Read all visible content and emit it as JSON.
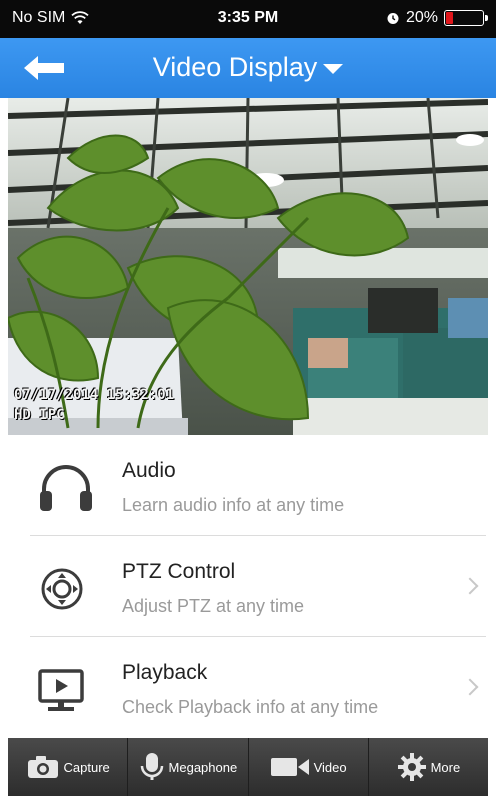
{
  "status_bar": {
    "carrier": "No SIM",
    "time": "3:35 PM",
    "battery_text": "20%",
    "battery_level": 0.2,
    "battery_color": "#e0161b"
  },
  "nav": {
    "title": "Video Display",
    "back_icon": "arrow-left-icon",
    "dropdown_icon": "caret-down-icon",
    "accent": "#2f8ce8"
  },
  "video": {
    "timestamp": "07/17/2014 15:32:01",
    "channel": "HD IPC"
  },
  "menu": [
    {
      "title": "Audio",
      "subtitle": "Learn audio info at any time",
      "icon": "headphones-icon",
      "has_chevron": false
    },
    {
      "title": "PTZ Control",
      "subtitle": "Adjust PTZ at any time",
      "icon": "ptz-joystick-icon",
      "has_chevron": true
    },
    {
      "title": "Playback",
      "subtitle": "Check Playback info at any time",
      "icon": "playback-monitor-icon",
      "has_chevron": true
    }
  ],
  "toolbar": {
    "capture": "Capture",
    "megaphone": "Megaphone",
    "video": "Video",
    "more": "More"
  }
}
